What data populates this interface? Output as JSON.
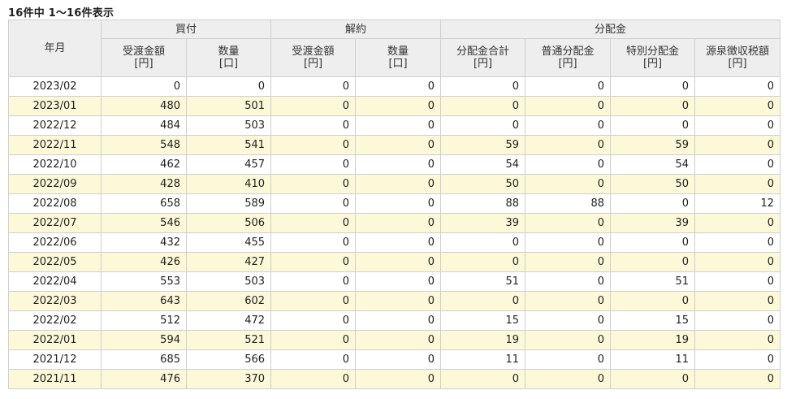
{
  "result_count": "16件中 1～16件表示",
  "header": {
    "month": "年月",
    "groups": {
      "buy": "買付",
      "cancel": "解約",
      "dividend": "分配金"
    },
    "columns": [
      {
        "name": "受渡金額",
        "unit": "[円]"
      },
      {
        "name": "数量",
        "unit": "[口]"
      },
      {
        "name": "受渡金額",
        "unit": "[円]"
      },
      {
        "name": "数量",
        "unit": "[口]"
      },
      {
        "name": "分配金合計",
        "unit": "[円]"
      },
      {
        "name": "普通分配金",
        "unit": "[円]"
      },
      {
        "name": "特別分配金",
        "unit": "[円]"
      },
      {
        "name": "源泉徴収税額",
        "unit": "[円]"
      }
    ]
  },
  "rows": [
    {
      "month": "2023/02",
      "values": [
        "0",
        "0",
        "0",
        "0",
        "0",
        "0",
        "0",
        "0"
      ]
    },
    {
      "month": "2023/01",
      "values": [
        "480",
        "501",
        "0",
        "0",
        "0",
        "0",
        "0",
        "0"
      ]
    },
    {
      "month": "2022/12",
      "values": [
        "484",
        "503",
        "0",
        "0",
        "0",
        "0",
        "0",
        "0"
      ]
    },
    {
      "month": "2022/11",
      "values": [
        "548",
        "541",
        "0",
        "0",
        "59",
        "0",
        "59",
        "0"
      ]
    },
    {
      "month": "2022/10",
      "values": [
        "462",
        "457",
        "0",
        "0",
        "54",
        "0",
        "54",
        "0"
      ]
    },
    {
      "month": "2022/09",
      "values": [
        "428",
        "410",
        "0",
        "0",
        "50",
        "0",
        "50",
        "0"
      ]
    },
    {
      "month": "2022/08",
      "values": [
        "658",
        "589",
        "0",
        "0",
        "88",
        "88",
        "0",
        "12"
      ]
    },
    {
      "month": "2022/07",
      "values": [
        "546",
        "506",
        "0",
        "0",
        "39",
        "0",
        "39",
        "0"
      ]
    },
    {
      "month": "2022/06",
      "values": [
        "432",
        "455",
        "0",
        "0",
        "0",
        "0",
        "0",
        "0"
      ]
    },
    {
      "month": "2022/05",
      "values": [
        "426",
        "427",
        "0",
        "0",
        "0",
        "0",
        "0",
        "0"
      ]
    },
    {
      "month": "2022/04",
      "values": [
        "553",
        "503",
        "0",
        "0",
        "51",
        "0",
        "51",
        "0"
      ]
    },
    {
      "month": "2022/03",
      "values": [
        "643",
        "602",
        "0",
        "0",
        "0",
        "0",
        "0",
        "0"
      ]
    },
    {
      "month": "2022/02",
      "values": [
        "512",
        "472",
        "0",
        "0",
        "15",
        "0",
        "15",
        "0"
      ]
    },
    {
      "month": "2022/01",
      "values": [
        "594",
        "521",
        "0",
        "0",
        "19",
        "0",
        "19",
        "0"
      ]
    },
    {
      "month": "2021/12",
      "values": [
        "685",
        "566",
        "0",
        "0",
        "11",
        "0",
        "11",
        "0"
      ]
    },
    {
      "month": "2021/11",
      "values": [
        "476",
        "370",
        "0",
        "0",
        "0",
        "0",
        "0",
        "0"
      ]
    }
  ],
  "colors": {
    "header_bg": "#eeeeee",
    "stripe_bg": "#fcf8d8",
    "border": "#cfcfcf"
  }
}
